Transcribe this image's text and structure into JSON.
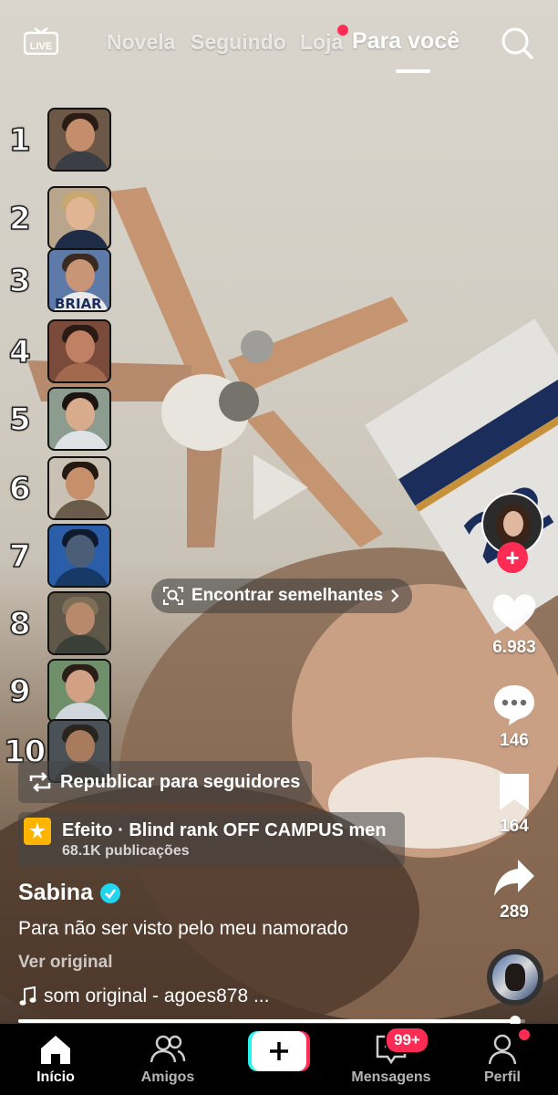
{
  "top_nav": {
    "live_label": "LIVE",
    "tabs": [
      {
        "label": "Novela",
        "active": false
      },
      {
        "label": "Seguindo",
        "active": false
      },
      {
        "label": "Loja",
        "active": false,
        "has_dot": true
      },
      {
        "label": "Para você",
        "active": true
      }
    ],
    "search_icon": "search-icon"
  },
  "ranking": {
    "items": [
      {
        "rank": "1"
      },
      {
        "rank": "2"
      },
      {
        "rank": "3",
        "jersey_text": "BRIAR"
      },
      {
        "rank": "4"
      },
      {
        "rank": "5"
      },
      {
        "rank": "6"
      },
      {
        "rank": "7"
      },
      {
        "rank": "8"
      },
      {
        "rank": "9"
      },
      {
        "rank": "10"
      }
    ]
  },
  "find_similar": {
    "label": "Encontrar semelhantes"
  },
  "actions": {
    "likes": "6.983",
    "comments": "146",
    "saves": "164",
    "shares": "289"
  },
  "repost": {
    "label": "Republicar para seguidores"
  },
  "effect": {
    "title": "Efeito · Blind rank OFF CAMPUS men",
    "subtitle": "68.1K publicações"
  },
  "post": {
    "username": "Sabina",
    "caption": "Para não ser visto pelo meu namorado",
    "see_original": "Ver original",
    "sound": "som original - agoes878 ..."
  },
  "progress": {
    "fraction": 0.98
  },
  "tabbar": {
    "tabs": [
      {
        "label": "Início",
        "active": true
      },
      {
        "label": "Amigos",
        "active": false
      },
      {
        "label": "Mensagens",
        "active": false
      },
      {
        "label": "Perfil",
        "active": false
      }
    ],
    "messages_badge": "99+"
  },
  "colors": {
    "accent": "#fe2c55",
    "verified": "#20d5ec",
    "create_cyan": "#25f4ee"
  }
}
